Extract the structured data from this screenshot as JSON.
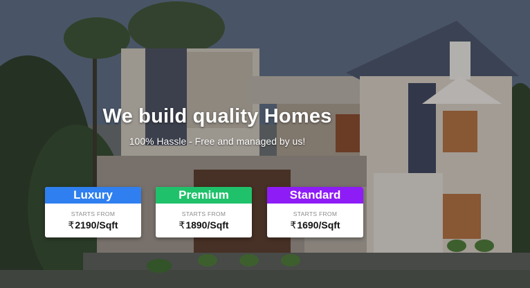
{
  "hero": {
    "headline": "We build quality Homes",
    "subline": "100% Hassle - Free and managed by us!"
  },
  "packages": [
    {
      "name": "Luxury",
      "starts_label": "STARTS FROM",
      "currency": "₹",
      "price": "2190/Sqft",
      "color": "#2f7ff0"
    },
    {
      "name": "Premium",
      "starts_label": "STARTS FROM",
      "currency": "₹",
      "price": "1890/Sqft",
      "color": "#1fc26b"
    },
    {
      "name": "Standard",
      "starts_label": "STARTS FROM",
      "currency": "₹",
      "price": "1690/Sqft",
      "color": "#8e1cf6"
    }
  ]
}
